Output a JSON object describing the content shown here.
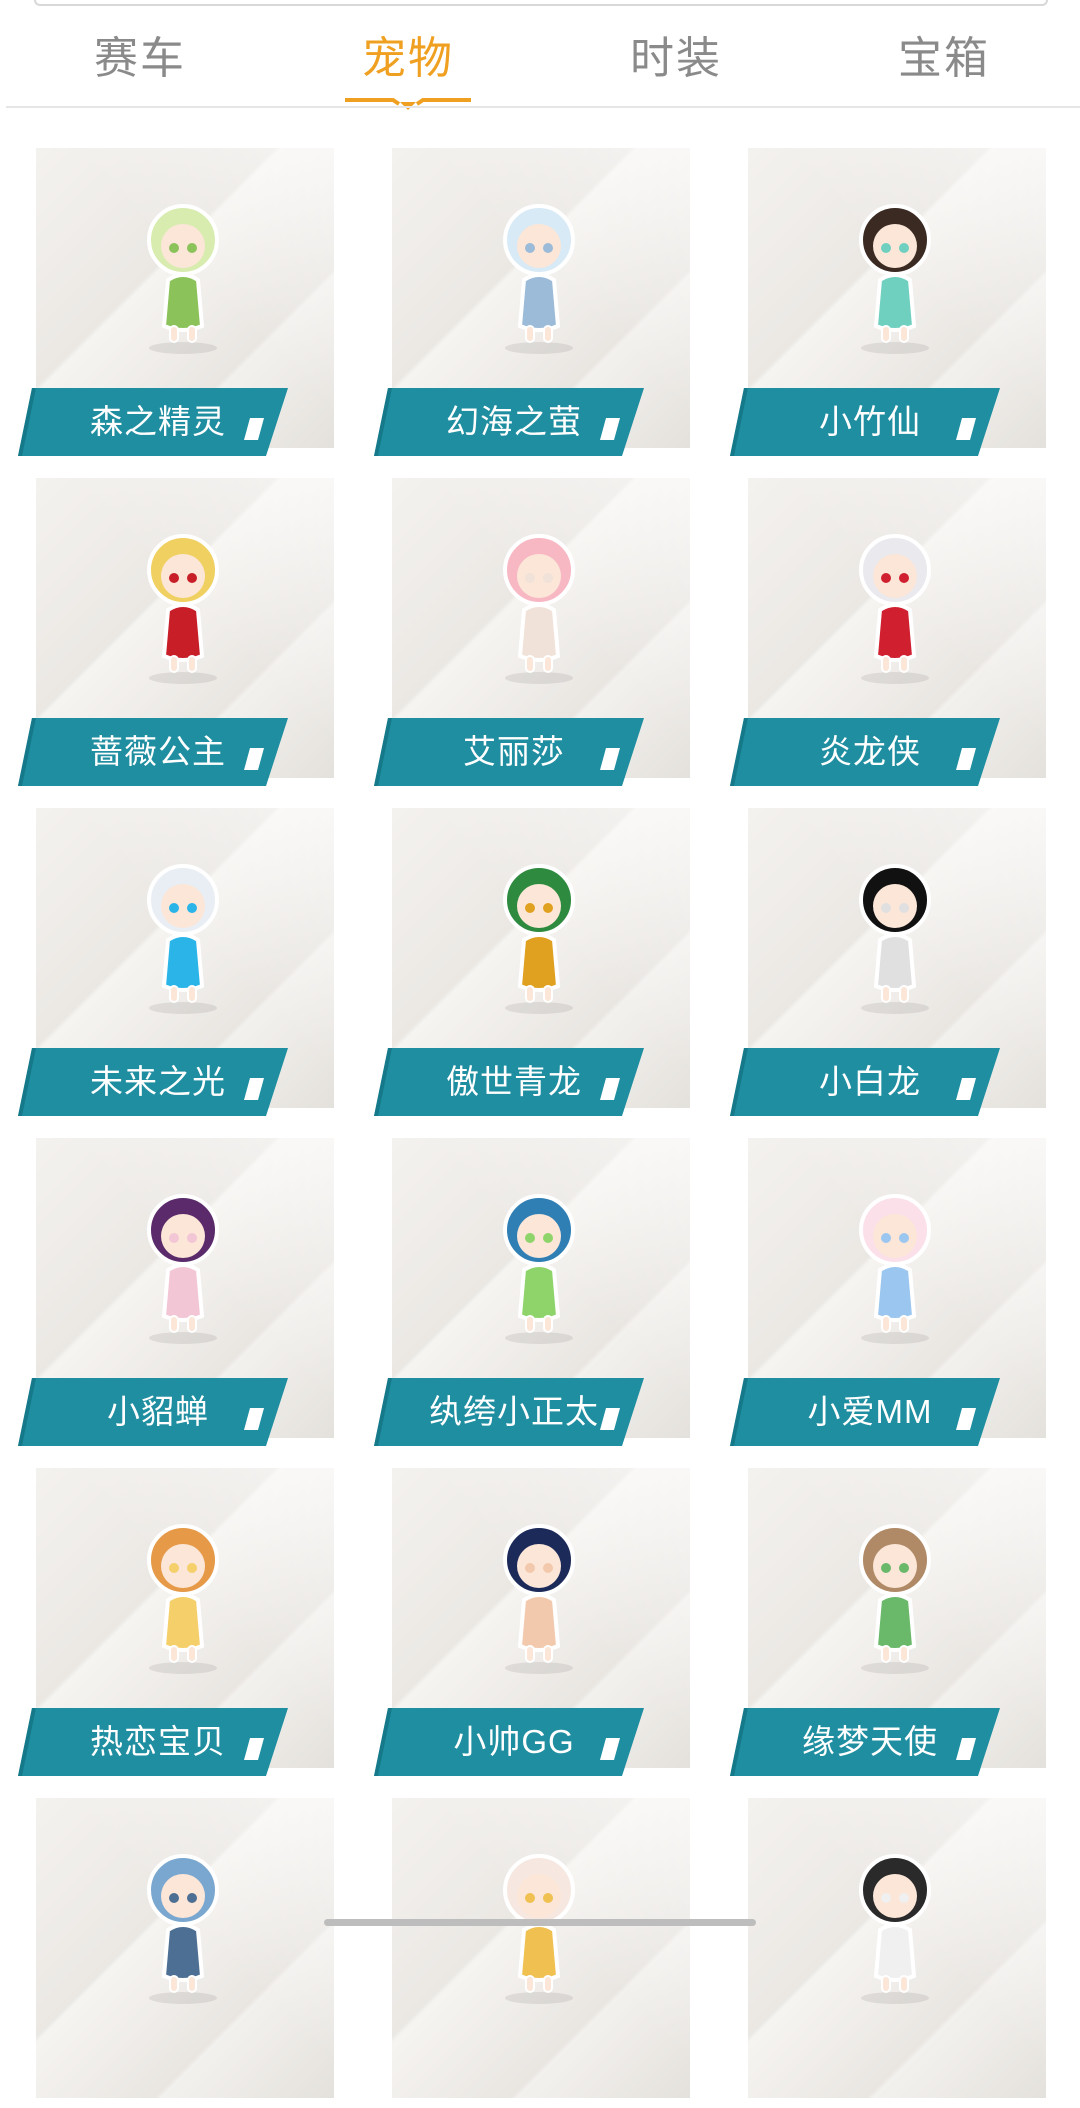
{
  "tabs": [
    {
      "label": "赛车",
      "active": false
    },
    {
      "label": "宠物",
      "active": true
    },
    {
      "label": "时装",
      "active": false
    },
    {
      "label": "宝箱",
      "active": false
    }
  ],
  "colors": {
    "accent": "#f0a020",
    "label_bar": "#1e8ea0",
    "tab_inactive": "#8a8a8a"
  },
  "pets": [
    {
      "name": "森之精灵",
      "icon": "forest-elf-character"
    },
    {
      "name": "幻海之萤",
      "icon": "sea-firefly-character"
    },
    {
      "name": "小竹仙",
      "icon": "bamboo-fairy-character"
    },
    {
      "name": "蔷薇公主",
      "icon": "rose-princess-character"
    },
    {
      "name": "艾丽莎",
      "icon": "alisa-bunny-character"
    },
    {
      "name": "炎龙侠",
      "icon": "flame-dragon-hero-character"
    },
    {
      "name": "未来之光",
      "icon": "future-light-robot"
    },
    {
      "name": "傲世青龙",
      "icon": "green-dragon-mech"
    },
    {
      "name": "小白龙",
      "icon": "little-white-dragon-character"
    },
    {
      "name": "小貂蝉",
      "icon": "little-diaochan-character"
    },
    {
      "name": "纨绔小正太",
      "icon": "shark-hood-boy-character"
    },
    {
      "name": "小爱MM",
      "icon": "bear-hat-girl-character"
    },
    {
      "name": "热恋宝贝",
      "icon": "sweetheart-twins-character"
    },
    {
      "name": "小帅GG",
      "icon": "baby-boy-car-character"
    },
    {
      "name": "缘梦天使",
      "icon": "dream-angel-character"
    },
    {
      "name": "",
      "icon": "blue-dragon-character"
    },
    {
      "name": "",
      "icon": "sheep-star-character"
    },
    {
      "name": "",
      "icon": "eagle-character"
    }
  ]
}
